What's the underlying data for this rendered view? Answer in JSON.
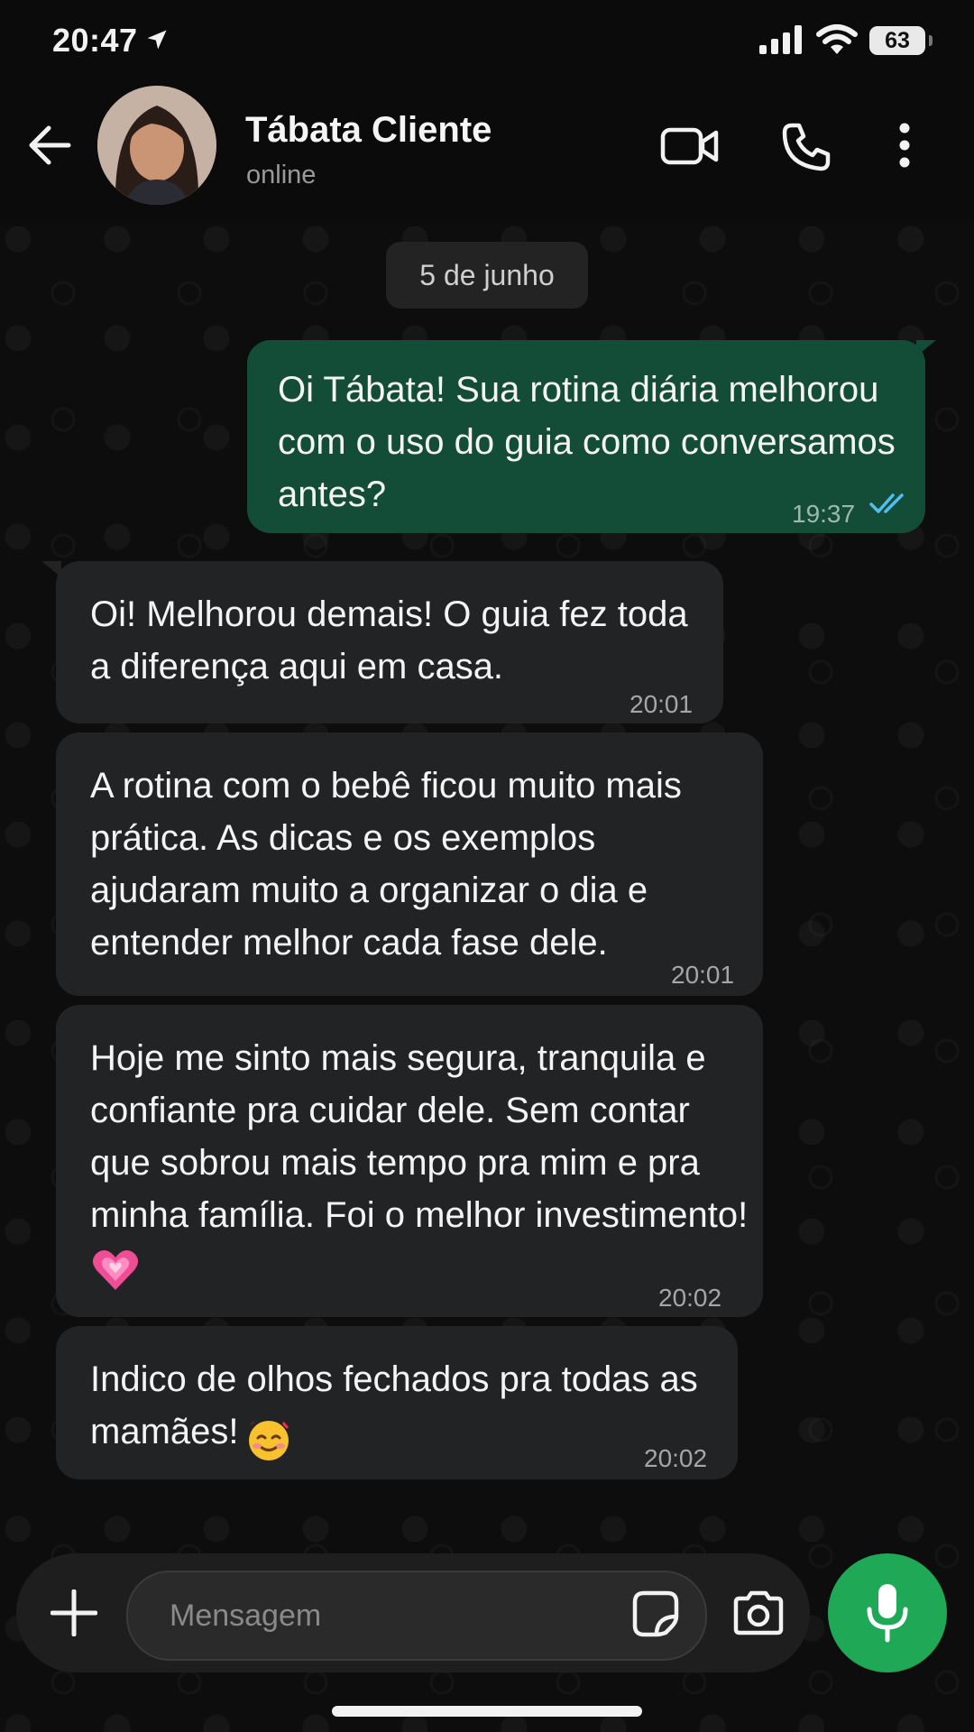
{
  "status_bar": {
    "time": "20:47",
    "battery": "63"
  },
  "header": {
    "contact_name": "Tábata Cliente",
    "contact_status": "online"
  },
  "date_chip": "5 de junho",
  "messages": [
    {
      "direction": "outgoing",
      "text": "Oi Tábata! Sua rotina diária melhorou com o uso do guia como conversamos antes?",
      "time": "19:37",
      "read": true
    },
    {
      "direction": "incoming",
      "text": "Oi! Melhorou demais! O guia fez toda a diferença aqui em casa.",
      "time": "20:01"
    },
    {
      "direction": "incoming",
      "text": "A rotina com o bebê ficou muito mais prática. As dicas e os exemplos ajudaram muito a organizar o dia e entender melhor cada fase dele.",
      "time": "20:01"
    },
    {
      "direction": "incoming",
      "text": "Hoje me sinto mais segura, tranquila e confiante pra cuidar dele. Sem contar que sobrou mais tempo pra mim e pra minha família. Foi o melhor investimento!",
      "emoji": "growing-heart",
      "time": "20:02"
    },
    {
      "direction": "incoming",
      "text": "Indico de olhos fechados pra todas as mamães!",
      "emoji": "smiling-face-with-hearts",
      "time": "20:02"
    }
  ],
  "composer": {
    "placeholder": "Mensagem"
  },
  "colors": {
    "outgoing_bubble": "#144d37",
    "incoming_bubble": "#222324",
    "mic_button": "#1fa855",
    "read_ticks": "#53bdeb"
  }
}
